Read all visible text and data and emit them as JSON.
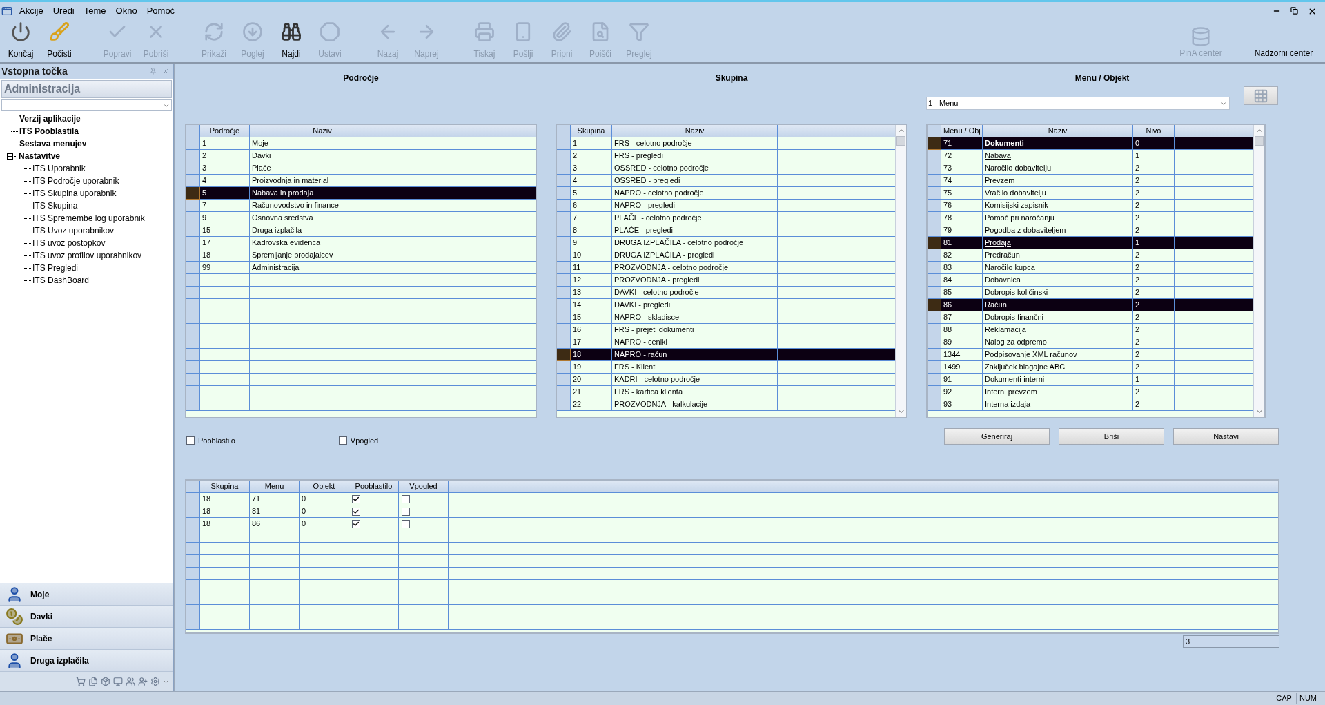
{
  "menu": [
    "Akcije",
    "Uredi",
    "Teme",
    "Okno",
    "Pomoč"
  ],
  "toolbar": [
    [
      {
        "label": "Končaj",
        "disabled": false
      },
      {
        "label": "Počisti",
        "disabled": false
      }
    ],
    [
      {
        "label": "Popravi",
        "disabled": true
      },
      {
        "label": "Pobriši",
        "disabled": true
      }
    ],
    [
      {
        "label": "Prikaži",
        "disabled": true
      },
      {
        "label": "Poglej",
        "disabled": true
      },
      {
        "label": "Najdi",
        "disabled": false
      },
      {
        "label": "Ustavi",
        "disabled": true
      }
    ],
    [
      {
        "label": "Nazaj",
        "disabled": true
      },
      {
        "label": "Naprej",
        "disabled": true
      }
    ],
    [
      {
        "label": "Tiskaj",
        "disabled": true
      },
      {
        "label": "Pošlji",
        "disabled": true
      },
      {
        "label": "Pripni",
        "disabled": true
      },
      {
        "label": "Poišči",
        "disabled": true
      },
      {
        "label": "Preglej",
        "disabled": true
      }
    ]
  ],
  "toolbar_right": [
    {
      "label": "PinA center",
      "disabled": true
    },
    {
      "label": "Nadzorni center",
      "disabled": false
    }
  ],
  "sidebar": {
    "title": "Vstopna točka",
    "section": "Administracija",
    "tree": [
      {
        "label": "Verzij aplikacije"
      },
      {
        "label": "ITS Pooblastila"
      },
      {
        "label": "Sestava menujev"
      },
      {
        "label": "Nastavitve",
        "expanded": true,
        "children": [
          {
            "label": "ITS Uporabnik"
          },
          {
            "label": "ITS Področje uporabnik"
          },
          {
            "label": "ITS Skupina uporabnik"
          },
          {
            "label": "ITS Skupina"
          },
          {
            "label": "ITS Spremembe log uporabnik"
          },
          {
            "label": "ITS Uvoz uporabnikov"
          },
          {
            "label": "ITS uvoz postopkov"
          },
          {
            "label": "ITS uvoz profilov uporabnikov"
          },
          {
            "label": "ITS Pregledi"
          },
          {
            "label": "ITS DashBoard"
          }
        ]
      }
    ],
    "nav": [
      "Moje",
      "Davki",
      "Plače",
      "Druga izplačila"
    ]
  },
  "podrocje": {
    "title": "Področje",
    "columns": [
      "Področje",
      "Naziv"
    ],
    "rows": [
      {
        "cells": [
          "1",
          "Moje"
        ],
        "selected": false
      },
      {
        "cells": [
          "2",
          "Davki"
        ],
        "selected": false
      },
      {
        "cells": [
          "3",
          "Plače"
        ],
        "selected": false
      },
      {
        "cells": [
          "4",
          "Proizvodnja in material"
        ],
        "selected": false
      },
      {
        "cells": [
          "5",
          "Nabava in prodaja"
        ],
        "selected": true
      },
      {
        "cells": [
          "7",
          "Računovodstvo in finance"
        ],
        "selected": false
      },
      {
        "cells": [
          "9",
          "Osnovna sredstva"
        ],
        "selected": false
      },
      {
        "cells": [
          "15",
          "Druga izplačila"
        ],
        "selected": false
      },
      {
        "cells": [
          "17",
          "Kadrovska evidenca"
        ],
        "selected": false
      },
      {
        "cells": [
          "18",
          "Spremljanje prodajalcev"
        ],
        "selected": false
      },
      {
        "cells": [
          "99",
          "Administracija"
        ],
        "selected": false
      }
    ]
  },
  "skupina": {
    "title": "Skupina",
    "columns": [
      "Skupina",
      "Naziv"
    ],
    "rows": [
      {
        "cells": [
          "1",
          "FRS -  celotno področje"
        ],
        "selected": false
      },
      {
        "cells": [
          "2",
          "FRS - pregledi"
        ],
        "selected": false
      },
      {
        "cells": [
          "3",
          "OSSRED - celotno področje"
        ],
        "selected": false
      },
      {
        "cells": [
          "4",
          "OSSRED - pregledi"
        ],
        "selected": false
      },
      {
        "cells": [
          "5",
          "NAPRO - celotno področje"
        ],
        "selected": false
      },
      {
        "cells": [
          "6",
          "NAPRO - pregledi"
        ],
        "selected": false
      },
      {
        "cells": [
          "7",
          "PLAČE - celotno področje"
        ],
        "selected": false
      },
      {
        "cells": [
          "8",
          "PLAČE - pregledi"
        ],
        "selected": false
      },
      {
        "cells": [
          "9",
          "DRUGA IZPLAČILA - celotno področje"
        ],
        "selected": false
      },
      {
        "cells": [
          "10",
          "DRUGA IZPLAČILA - pregledi"
        ],
        "selected": false
      },
      {
        "cells": [
          "11",
          "PROZVODNJA - celotno področje"
        ],
        "selected": false
      },
      {
        "cells": [
          "12",
          "PROZVODNJA - pregledi"
        ],
        "selected": false
      },
      {
        "cells": [
          "13",
          "DAVKI - celotno področje"
        ],
        "selected": false
      },
      {
        "cells": [
          "14",
          "DAVKI - pregledi"
        ],
        "selected": false
      },
      {
        "cells": [
          "15",
          "NAPRO - skladisce"
        ],
        "selected": false
      },
      {
        "cells": [
          "16",
          "FRS - prejeti dokumenti"
        ],
        "selected": false
      },
      {
        "cells": [
          "17",
          "NAPRO - ceniki"
        ],
        "selected": false
      },
      {
        "cells": [
          "18",
          "NAPRO - račun"
        ],
        "selected": true
      },
      {
        "cells": [
          "19",
          "FRS - Klienti"
        ],
        "selected": false
      },
      {
        "cells": [
          "20",
          "KADRI - celotno področje"
        ],
        "selected": false
      },
      {
        "cells": [
          "21",
          "FRS - kartica klienta"
        ],
        "selected": false
      },
      {
        "cells": [
          "22",
          "PROZVODNJA - kalkulacije"
        ],
        "selected": false
      }
    ]
  },
  "menu_objekt": {
    "title": "Menu / Objekt",
    "type_select": {
      "value": "1 - Menu"
    },
    "columns": [
      "Menu / Obj",
      "Naziv",
      "Nivo"
    ],
    "rows": [
      {
        "cells": [
          "71",
          "Dokumenti",
          "0"
        ],
        "kind": "root",
        "selected": true
      },
      {
        "cells": [
          "72",
          "Nabava",
          "1"
        ],
        "kind": "group",
        "selected": false
      },
      {
        "cells": [
          "73",
          "Naročilo dobavitelju",
          "2"
        ],
        "kind": "item",
        "selected": false
      },
      {
        "cells": [
          "74",
          "Prevzem",
          "2"
        ],
        "kind": "item",
        "selected": false
      },
      {
        "cells": [
          "75",
          "Vračilo dobavitelju",
          "2"
        ],
        "kind": "item",
        "selected": false
      },
      {
        "cells": [
          "76",
          "Komisijski zapisnik",
          "2"
        ],
        "kind": "item",
        "selected": false
      },
      {
        "cells": [
          "78",
          "Pomoč pri naročanju",
          "2"
        ],
        "kind": "item",
        "selected": false
      },
      {
        "cells": [
          "79",
          "Pogodba z dobaviteljem",
          "2"
        ],
        "kind": "item",
        "selected": false
      },
      {
        "cells": [
          "81",
          "Prodaja",
          "1"
        ],
        "kind": "group",
        "selected": true
      },
      {
        "cells": [
          "82",
          "Predračun",
          "2"
        ],
        "kind": "item",
        "selected": false
      },
      {
        "cells": [
          "83",
          "Naročilo kupca",
          "2"
        ],
        "kind": "item",
        "selected": false
      },
      {
        "cells": [
          "84",
          "Dobavnica",
          "2"
        ],
        "kind": "item",
        "selected": false
      },
      {
        "cells": [
          "85",
          "Dobropis količinski",
          "2"
        ],
        "kind": "item",
        "selected": false
      },
      {
        "cells": [
          "86",
          "Račun",
          "2"
        ],
        "kind": "item",
        "selected": true
      },
      {
        "cells": [
          "87",
          "Dobropis finančni",
          "2"
        ],
        "kind": "item",
        "selected": false
      },
      {
        "cells": [
          "88",
          "Reklamacija",
          "2"
        ],
        "kind": "item",
        "selected": false
      },
      {
        "cells": [
          "89",
          "Nalog za odpremo",
          "2"
        ],
        "kind": "item",
        "selected": false
      },
      {
        "cells": [
          "1344",
          "Podpisovanje XML računov",
          "2"
        ],
        "kind": "item",
        "selected": false
      },
      {
        "cells": [
          "1499",
          "Zaključek blagajne ABC",
          "2"
        ],
        "kind": "item",
        "selected": false
      },
      {
        "cells": [
          "91",
          "Dokumenti-interni",
          "1"
        ],
        "kind": "group",
        "selected": false
      },
      {
        "cells": [
          "92",
          "Interni prevzem",
          "2"
        ],
        "kind": "item",
        "selected": false
      },
      {
        "cells": [
          "93",
          "Interna izdaja",
          "2"
        ],
        "kind": "item",
        "selected": false
      }
    ]
  },
  "options": [
    {
      "label": "Pooblastilo",
      "checked": false
    },
    {
      "label": "Vpogled",
      "checked": false
    }
  ],
  "buttons": [
    "Generiraj",
    "Briši",
    "Nastavi"
  ],
  "rights": {
    "columns": [
      "Skupina",
      "Menu",
      "Objekt",
      "Pooblastilo",
      "Vpogled"
    ],
    "rows": [
      {
        "skupina": "18",
        "menu": "71",
        "objekt": "0",
        "pooblastilo": true,
        "vpogled": false
      },
      {
        "skupina": "18",
        "menu": "81",
        "objekt": "0",
        "pooblastilo": true,
        "vpogled": false
      },
      {
        "skupina": "18",
        "menu": "86",
        "objekt": "0",
        "pooblastilo": true,
        "vpogled": false
      }
    ],
    "count": "3"
  },
  "status_bar": [
    "CAP",
    "NUM"
  ]
}
